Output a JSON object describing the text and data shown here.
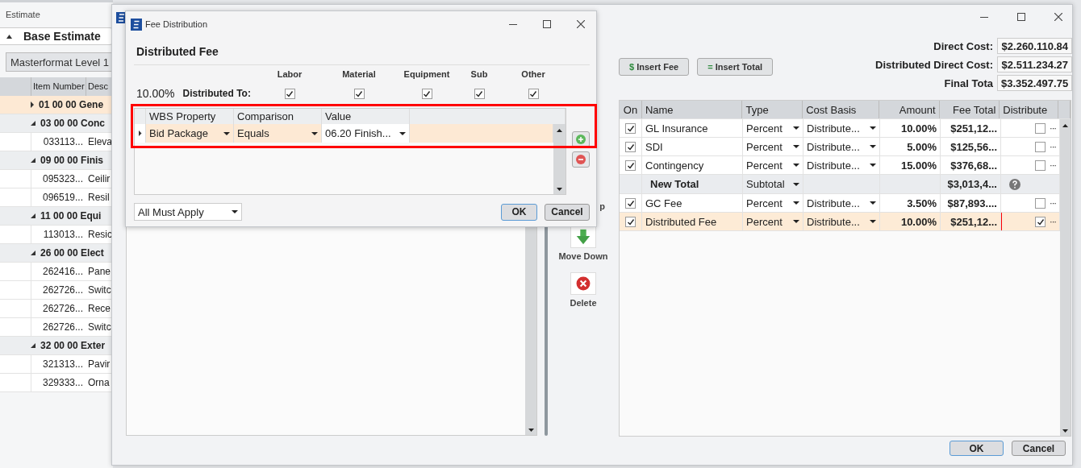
{
  "estimate_panel": {
    "title": "Estimate",
    "section": "Base Estimate",
    "grouping": "Masterformat Level 1",
    "columns": [
      "Item Number",
      "Desc"
    ],
    "rows": [
      {
        "kind": "group",
        "expanded": false,
        "selected": true,
        "label": "01 00 00 Gene"
      },
      {
        "kind": "group",
        "expanded": true,
        "selected": false,
        "label": "03 00 00 Conc"
      },
      {
        "kind": "item",
        "selected": false,
        "item": "033113...",
        "description": "Eleva"
      },
      {
        "kind": "group",
        "expanded": true,
        "selected": false,
        "label": "09 00 00 Finis"
      },
      {
        "kind": "item",
        "selected": false,
        "item": "095323...",
        "description": "Ceilir"
      },
      {
        "kind": "item",
        "selected": false,
        "item": "096519...",
        "description": "Resil"
      },
      {
        "kind": "group",
        "expanded": true,
        "selected": false,
        "label": "11 00 00 Equi"
      },
      {
        "kind": "item",
        "selected": false,
        "item": "113013...",
        "description": "Resic"
      },
      {
        "kind": "group",
        "expanded": true,
        "selected": false,
        "label": "26 00 00 Elect"
      },
      {
        "kind": "item",
        "selected": false,
        "item": "262416...",
        "description": "Pane"
      },
      {
        "kind": "item",
        "selected": false,
        "item": "262726...",
        "description": "Switc"
      },
      {
        "kind": "item",
        "selected": false,
        "item": "262726...",
        "description": "Rece"
      },
      {
        "kind": "item",
        "selected": false,
        "item": "262726...",
        "description": "Switc"
      },
      {
        "kind": "group",
        "expanded": true,
        "selected": false,
        "label": "32 00 00 Exter"
      },
      {
        "kind": "item",
        "selected": false,
        "item": "321313...",
        "description": "Pavir"
      },
      {
        "kind": "item",
        "selected": false,
        "item": "329333...",
        "description": "Orna"
      }
    ]
  },
  "fees_window": {
    "side_buttons": [
      {
        "kind": "up",
        "label": "p"
      },
      {
        "kind": "down",
        "label": "Move Down"
      },
      {
        "kind": "delete",
        "label": "Delete"
      }
    ],
    "insert_buttons": [
      {
        "icon": "$",
        "label": "Insert Fee"
      },
      {
        "icon": "=",
        "label": "Insert Total"
      }
    ],
    "costs": [
      {
        "label": "Direct Cost:",
        "value": "$2.260.110.84"
      },
      {
        "label": "Distributed Direct Cost:",
        "value": "$2.511.234.27"
      },
      {
        "label": "Final Tota",
        "value": "$3.352.497.75"
      }
    ],
    "columns": [
      "On",
      "Name",
      "Type",
      "Cost Basis",
      "Amount",
      "Fee Total",
      "Distribute"
    ],
    "rows": [
      {
        "kind": "fee",
        "on": true,
        "name": "GL Insurance",
        "type": "Percent",
        "cost_basis": "Distribute...",
        "amount": "10.00%",
        "fee_total": "$251,12...",
        "distribute": false,
        "selected": false,
        "highlighted": false
      },
      {
        "kind": "fee",
        "on": true,
        "name": "SDI",
        "type": "Percent",
        "cost_basis": "Distribute...",
        "amount": "5.00%",
        "fee_total": "$125,56...",
        "distribute": false,
        "selected": false,
        "highlighted": false
      },
      {
        "kind": "fee",
        "on": true,
        "name": "Contingency",
        "type": "Percent",
        "cost_basis": "Distribute...",
        "amount": "15.00%",
        "fee_total": "$376,68...",
        "distribute": false,
        "selected": false,
        "highlighted": false
      },
      {
        "kind": "subtotal",
        "name": "New Total",
        "type": "Subtotal",
        "fee_total": "$3,013,4...",
        "selected": false,
        "highlighted": false
      },
      {
        "kind": "fee",
        "on": true,
        "name": "GC Fee",
        "type": "Percent",
        "cost_basis": "Distribute...",
        "amount": "3.50%",
        "fee_total": "$87,893....",
        "distribute": false,
        "selected": false,
        "highlighted": false
      },
      {
        "kind": "fee",
        "on": true,
        "name": "Distributed Fee",
        "type": "Percent",
        "cost_basis": "Distribute...",
        "amount": "10.00%",
        "fee_total": "$251,12...",
        "distribute": true,
        "selected": true,
        "highlighted": true
      }
    ],
    "more_glyph": "···",
    "buttons": [
      "OK",
      "Cancel"
    ]
  },
  "fee_distribution": {
    "title": "Fee Distribution",
    "heading": "Distributed Fee",
    "percent": "10.00%",
    "distributed_to_label": "Distributed To:",
    "categories": [
      {
        "label": "Labor",
        "checked": true
      },
      {
        "label": "Material",
        "checked": true
      },
      {
        "label": "Equipment",
        "checked": true
      },
      {
        "label": "Sub",
        "checked": true
      },
      {
        "label": "Other",
        "checked": true
      }
    ],
    "criteria": {
      "highlighted": true,
      "columns": [
        "WBS Property",
        "Comparison",
        "Value"
      ],
      "rows": [
        {
          "selected": true,
          "property": "Bid Package",
          "comparison": "Equals",
          "value": "06.20 Finish..."
        }
      ]
    },
    "match_mode": "All Must Apply",
    "buttons": [
      "OK",
      "Cancel"
    ]
  }
}
